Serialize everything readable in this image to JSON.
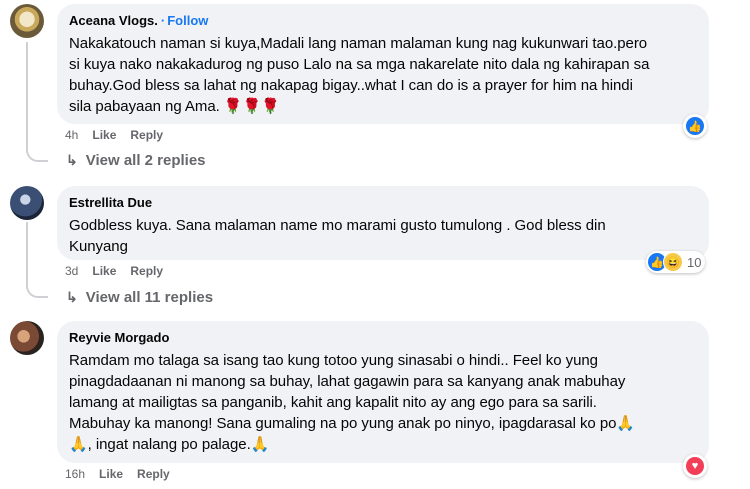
{
  "comments": [
    {
      "author": "Aceana Vlogs.",
      "follow": "Follow",
      "text": "Nakakatouch naman si kuya,Madali lang naman malaman kung nag kukunwari tao.pero\nsi kuya nako nakakadurog ng puso Lalo na sa mga nakarelate nito dala ng kahirapan sa\nbuhay.God bless sa lahat ng nakapag bigay..what I can do is a prayer for him na hindi\nsila pabayaan ng Ama. 🌹🌹🌹",
      "time": "4h",
      "like": "Like",
      "reply": "Reply",
      "reaction_icon": "like-icon",
      "replies_label": "View all 2 replies"
    },
    {
      "author": "Estrellita Due",
      "text": "Godbless kuya. Sana malaman name mo marami gusto tumulong . God bless din\nKunyang",
      "time": "3d",
      "like": "Like",
      "reply": "Reply",
      "reaction_count": "10",
      "replies_label": "View all 11 replies"
    },
    {
      "author": "Reyvie Morgado",
      "text": "Ramdam mo talaga sa isang tao kung totoo yung sinasabi o hindi.. Feel ko yung\npinagdadaanan ni manong sa buhay, lahat gagawin para sa kanyang anak mabuhay\nlamang at mailigtas sa panganib, kahit ang kapalit nito ay ang ego para sa sarili.\nMabuhay ka manong! Sana gumaling na po yung anak po ninyo, ipagdarasal ko po🙏\n🙏, ingat nalang po palage.🙏",
      "time": "16h",
      "like": "Like",
      "reply": "Reply",
      "reaction_icon": "heart-icon"
    }
  ],
  "colors": {
    "bubble": "#f0f2f5",
    "link": "#1877f2",
    "meta": "#65676b"
  }
}
